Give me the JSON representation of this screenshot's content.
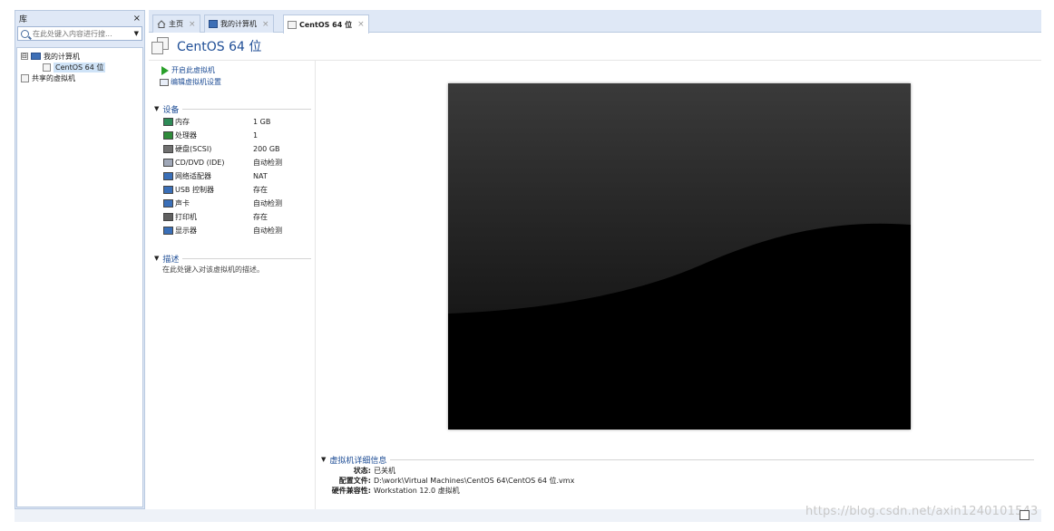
{
  "library": {
    "title": "库",
    "close": "×",
    "search_placeholder": "在此处键入内容进行搜...",
    "tree": {
      "root_toggle": "⊟",
      "my_computer": "我的计算机",
      "vm_item": "CentOS 64 位",
      "shared": "共享的虚拟机"
    }
  },
  "tabs": [
    {
      "label": "主页",
      "close": "×"
    },
    {
      "label": "我的计算机",
      "close": "×"
    },
    {
      "label": "CentOS 64 位",
      "close": "×"
    }
  ],
  "vm": {
    "title": "CentOS 64 位",
    "actions": {
      "power_on": "开启此虚拟机",
      "edit_settings": "编辑虚拟机设置"
    },
    "devices_header": "设备",
    "devices": [
      {
        "name": "内存",
        "value": "1 GB",
        "icon": "memory-icon",
        "color": "#2e8b57"
      },
      {
        "name": "处理器",
        "value": "1",
        "icon": "cpu-icon",
        "color": "#2e8b3a"
      },
      {
        "name": "硬盘(SCSI)",
        "value": "200 GB",
        "icon": "hard-disk-icon",
        "color": "#707070"
      },
      {
        "name": "CD/DVD (IDE)",
        "value": "自动检测",
        "icon": "cd-dvd-icon",
        "color": "#a0a8b8"
      },
      {
        "name": "网络适配器",
        "value": "NAT",
        "icon": "network-adapter-icon",
        "color": "#3a6fb8"
      },
      {
        "name": "USB 控制器",
        "value": "存在",
        "icon": "usb-icon",
        "color": "#3a6fb8"
      },
      {
        "name": "声卡",
        "value": "自动检测",
        "icon": "sound-card-icon",
        "color": "#3a6fb8"
      },
      {
        "name": "打印机",
        "value": "存在",
        "icon": "printer-icon",
        "color": "#606060"
      },
      {
        "name": "显示器",
        "value": "自动检测",
        "icon": "display-icon",
        "color": "#3a6fb8"
      }
    ],
    "description_header": "描述",
    "description_text": "在此处键入对该虚拟机的描述。",
    "details_header": "虚拟机详细信息",
    "details": {
      "state_label": "状态:",
      "state_value": "已关机",
      "config_label": "配置文件:",
      "config_value": "D:\\work\\Virtual Machines\\CentOS 64\\CentOS 64 位.vmx",
      "compat_label": "硬件兼容性:",
      "compat_value": "Workstation 12.0 虚拟机"
    }
  },
  "watermark": "https://blog.csdn.net/axin1240101543",
  "colors": {
    "accent": "#1f4e96",
    "panel_bg": "#dfe8f6",
    "power_green": "#2aa02a"
  }
}
